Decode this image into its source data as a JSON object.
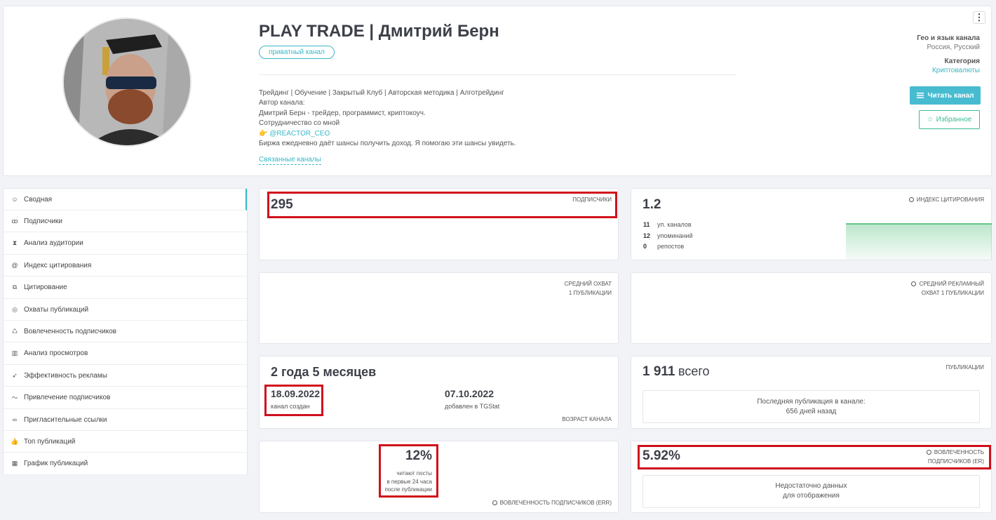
{
  "channel": {
    "title": "PLAY TRADE | Дмитрий Берн",
    "badge": "приватный канал",
    "description": [
      "Трейдинг | Обучение | Закрытый Клуб | Авторская методика | Алготрейдинг",
      "Автор канала:",
      "Дмитрий Берн - трейдер, программист, криптокоуч.",
      "Сотрудничество со мной"
    ],
    "contact_emoji": "👉",
    "contact_link": "@REACTOR_CEO",
    "description_tail": "Биржа ежедневно даёт шансы получить доход. Я помогаю эти шансы увидеть.",
    "related_link": "Связанные каналы",
    "geo_label": "Гео и язык канала",
    "geo_value": "Россия, Русский",
    "category_label": "Категория",
    "category_value": "Криптовалюты",
    "read_button": "Читать канал",
    "favorite_button": "Избранное",
    "menu": "⋮"
  },
  "sidebar": {
    "items": [
      {
        "label": "Сводная",
        "icon": "smile-icon",
        "glyph": "☺"
      },
      {
        "label": "Подписчики",
        "icon": "users-icon",
        "glyph": "ꝏ"
      },
      {
        "label": "Анализ аудитории",
        "icon": "hourglass-icon",
        "glyph": "⧗"
      },
      {
        "label": "Индекс цитирования",
        "icon": "at-icon",
        "glyph": "@"
      },
      {
        "label": "Цитирование",
        "icon": "copy-icon",
        "glyph": "⧉"
      },
      {
        "label": "Охваты публикаций",
        "icon": "eye-icon",
        "glyph": "◎"
      },
      {
        "label": "Вовлеченность подписчиков",
        "icon": "engagement-icon",
        "glyph": "♺"
      },
      {
        "label": "Анализ просмотров",
        "icon": "bar-chart-icon",
        "glyph": "▥"
      },
      {
        "label": "Эффективность рекламы",
        "icon": "rocket-icon",
        "glyph": "➶"
      },
      {
        "label": "Привлечение подписчиков",
        "icon": "trend-icon",
        "glyph": "〜"
      },
      {
        "label": "Пригласительные ссылки",
        "icon": "link-icon",
        "glyph": "∞"
      },
      {
        "label": "Топ публикаций",
        "icon": "thumbs-up-icon",
        "glyph": "👍"
      },
      {
        "label": "График публикаций",
        "icon": "calendar-icon",
        "glyph": "▦"
      }
    ]
  },
  "subscribers": {
    "value": "295",
    "label": "ПОДПИСЧИКИ"
  },
  "citation": {
    "value": "1.2",
    "label": "ИНДЕКС ЦИТИРОВАНИЯ",
    "rows": [
      {
        "num": "11",
        "text": "уп. каналов"
      },
      {
        "num": "12",
        "text": "упоминаний"
      },
      {
        "num": "0",
        "text": "репостов"
      }
    ]
  },
  "avg_reach": {
    "label_1": "СРЕДНИЙ ОХВАТ",
    "label_2": "1 ПУБЛИКАЦИИ"
  },
  "avg_ad_reach": {
    "label_1": "СРЕДНИЙ РЕКЛАМНЫЙ",
    "label_2": "ОХВАТ 1 ПУБЛИКАЦИИ"
  },
  "age": {
    "value": "2 года 5 месяцев",
    "created_date": "18.09.2022",
    "created_label": "канал создан",
    "added_date": "07.10.2022",
    "added_label": "добавлен в TGStat",
    "label": "ВОЗРАСТ КАНАЛА"
  },
  "posts": {
    "count": "1 911",
    "count_suffix": "всего",
    "label": "ПУБЛИКАЦИИ",
    "last_1": "Последняя публикация в канале:",
    "last_2": "656 дней назад"
  },
  "err": {
    "value": "12%",
    "sub_1": "читают посты",
    "sub_2": "в первые 24 часа",
    "sub_3": "после публикации",
    "label": "ВОВЛЕЧЕННОСТЬ ПОДПИСЧИКОВ (ERR)"
  },
  "er": {
    "value": "5.92%",
    "label_1": "ВОВЛЕЧЕННОСТЬ",
    "label_2": "ПОДПИСЧИКОВ (ER)",
    "empty_1": "Недостаточно данных",
    "empty_2": "для отображения"
  },
  "colors": {
    "accent": "#39b7c6",
    "highlight": "#d0101c",
    "favorite": "#3bbd99",
    "chart_line": "#3fb96b"
  }
}
